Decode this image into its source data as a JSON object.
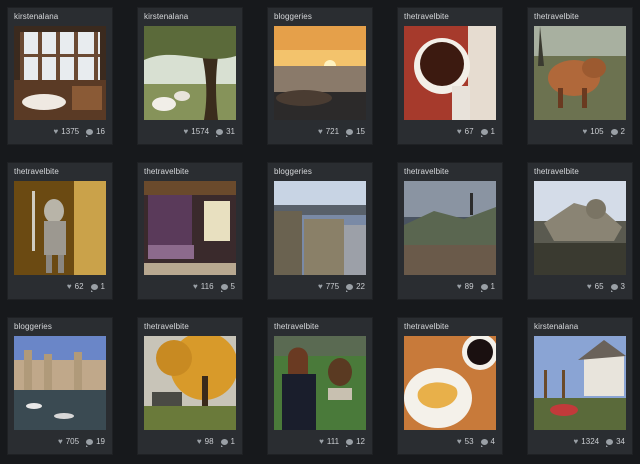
{
  "posts": [
    {
      "user": "kirstenalana",
      "likes": "1375",
      "comments": "16",
      "image": "restaurant-windows-photo"
    },
    {
      "user": "kirstenalana",
      "likes": "1574",
      "comments": "31",
      "image": "sheep-under-tree-photo"
    },
    {
      "user": "bloggeries",
      "likes": "721",
      "comments": "15",
      "image": "sunset-coast-photo"
    },
    {
      "user": "thetravelbite",
      "likes": "67",
      "comments": "1",
      "image": "tea-cup-photo"
    },
    {
      "user": "thetravelbite",
      "likes": "105",
      "comments": "2",
      "image": "highland-cow-photo"
    },
    {
      "user": "thetravelbite",
      "likes": "62",
      "comments": "1",
      "image": "suit-of-armour-photo"
    },
    {
      "user": "thetravelbite",
      "likes": "116",
      "comments": "5",
      "image": "canopy-bed-photo"
    },
    {
      "user": "bloggeries",
      "likes": "775",
      "comments": "22",
      "image": "castle-ruins-photo"
    },
    {
      "user": "thetravelbite",
      "likes": "89",
      "comments": "1",
      "image": "valley-monument-photo"
    },
    {
      "user": "thetravelbite",
      "likes": "65",
      "comments": "3",
      "image": "stone-sculpture-photo"
    },
    {
      "user": "bloggeries",
      "likes": "705",
      "comments": "19",
      "image": "harbour-castle-photo"
    },
    {
      "user": "thetravelbite",
      "likes": "98",
      "comments": "1",
      "image": "autumn-tree-photo"
    },
    {
      "user": "thetravelbite",
      "likes": "111",
      "comments": "12",
      "image": "woman-with-owl-photo"
    },
    {
      "user": "thetravelbite",
      "likes": "53",
      "comments": "4",
      "image": "shortbread-coffee-photo"
    },
    {
      "user": "kirstenalana",
      "likes": "1324",
      "comments": "34",
      "image": "cottage-garden-photo"
    }
  ]
}
